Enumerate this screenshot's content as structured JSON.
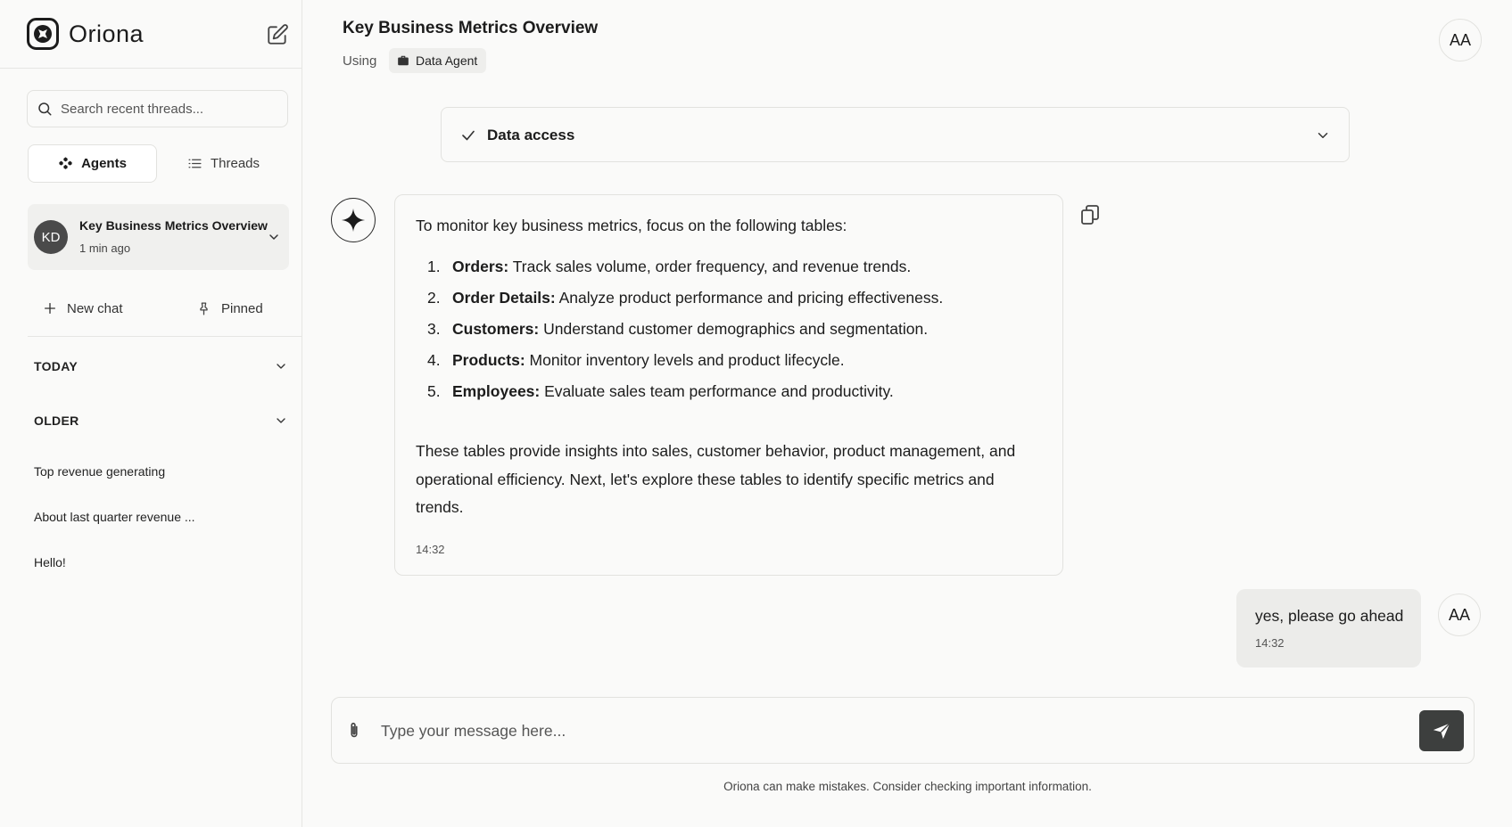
{
  "brand": {
    "name": "Oriona"
  },
  "sidebar": {
    "search_placeholder": "Search recent threads...",
    "tabs": [
      {
        "label": "Agents",
        "active": true
      },
      {
        "label": "Threads",
        "active": false
      }
    ],
    "current_thread": {
      "initials": "KD",
      "title": "Key Business Metrics Overview",
      "time": "1 min ago"
    },
    "actions": {
      "new_chat": "New chat",
      "pinned": "Pinned"
    },
    "sections": {
      "today": "TODAY",
      "older": "OLDER"
    },
    "history": [
      "Top revenue generating",
      "About last quarter revenue ...",
      "Hello!"
    ]
  },
  "header": {
    "title": "Key Business Metrics Overview",
    "using_label": "Using",
    "agent": "Data Agent",
    "user_initials": "AA"
  },
  "data_access": {
    "label": "Data access"
  },
  "bot_message": {
    "intro": "To monitor key business metrics, focus on the following tables:",
    "items": [
      {
        "num": "1.",
        "term": "Orders:",
        "text": " Track sales volume, order frequency, and revenue trends."
      },
      {
        "num": "2.",
        "term": "Order Details:",
        "text": " Analyze product performance and pricing effectiveness."
      },
      {
        "num": "3.",
        "term": "Customers:",
        "text": " Understand customer demographics and segmentation."
      },
      {
        "num": "4.",
        "term": "Products:",
        "text": " Monitor inventory levels and product lifecycle."
      },
      {
        "num": "5.",
        "term": "Employees:",
        "text": " Evaluate sales team performance and productivity."
      }
    ],
    "summary": "These tables provide insights into sales, customer behavior, product management, and operational efficiency. Next, let's explore these tables to identify specific metrics and trends.",
    "time": "14:32"
  },
  "user_message": {
    "text": "yes, please go ahead",
    "time": "14:32",
    "initials": "AA"
  },
  "composer": {
    "placeholder": "Type your message here..."
  },
  "disclaimer": "Oriona can make mistakes. Consider checking important information.",
  "colors": {
    "send_button": "#3d3f3e",
    "background": "#fafaf9",
    "bubble": "#ececea"
  }
}
